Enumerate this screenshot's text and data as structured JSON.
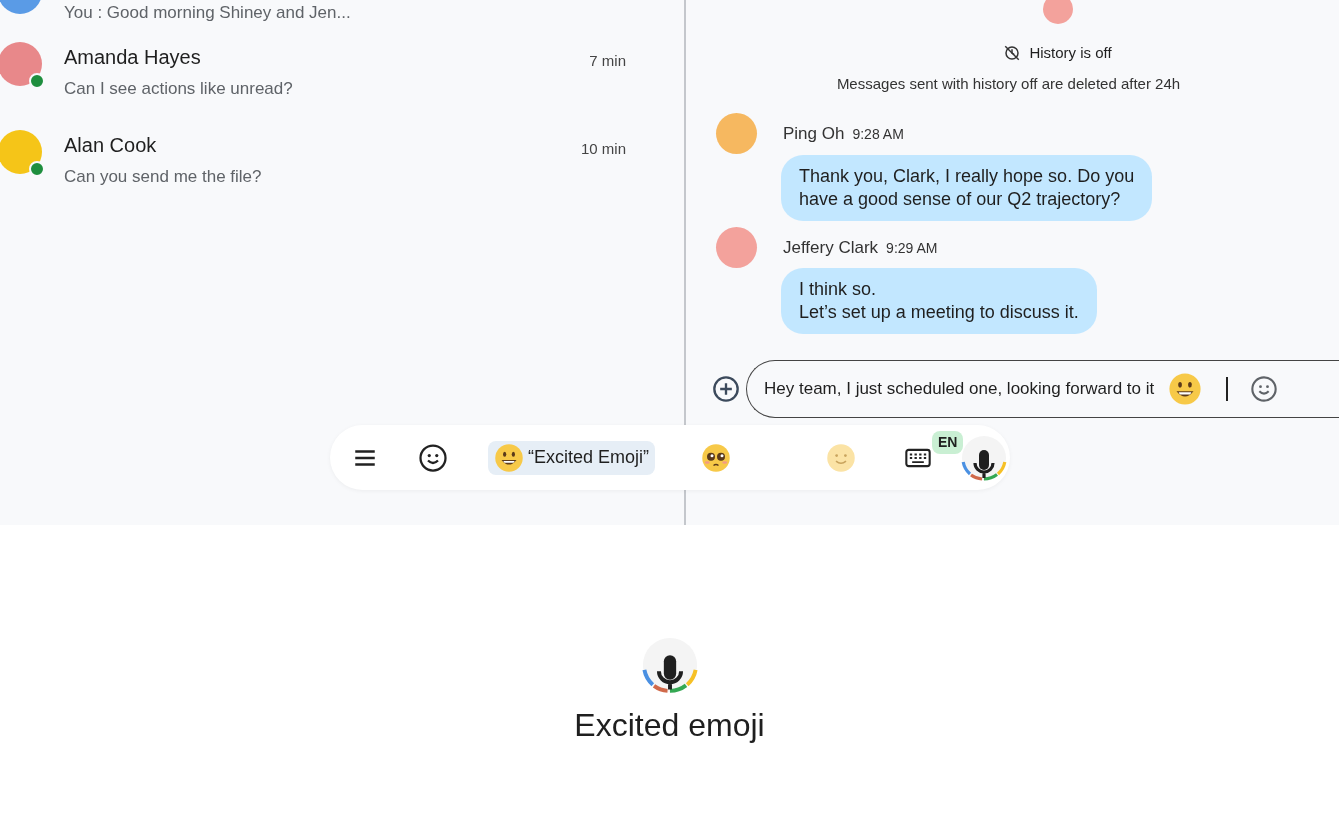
{
  "conversations": [
    {
      "preview": "You : Good morning Shiney and Jen...",
      "online": false,
      "color": "#5a9be6"
    },
    {
      "name": "Amanda Hayes",
      "preview": "Can I see actions like unread?",
      "time": "7 min",
      "online": true,
      "color": "#e8888a"
    },
    {
      "name": "Alan Cook",
      "preview": "Can you send me the file?",
      "time": "10 min",
      "online": true,
      "color": "#f5c518"
    }
  ],
  "chat": {
    "history_title": "History is off",
    "history_note": "Messages sent with history off are deleted after 24h",
    "messages": [
      {
        "sender": "Ping Oh",
        "time": "9:28 AM",
        "lines": [
          "Thank you, Clark, I really hope so. Do you",
          "have a good sense of our Q2 trajectory?"
        ],
        "color": "#f6b860"
      },
      {
        "sender": "Jeffery Clark",
        "time": "9:29 AM",
        "lines": [
          "I think so.",
          "Let’s set up a meeting to discuss it."
        ],
        "color": "#f3a29c"
      }
    ],
    "compose": {
      "value": "Hey team, I just scheduled one, looking forward to it"
    }
  },
  "keyboard": {
    "suggestions": [
      {
        "kind": "grin",
        "label": "“Excited Emoji”",
        "selected": true
      },
      {
        "kind": "pleading",
        "selected": false
      },
      {
        "kind": "smile",
        "selected": false
      }
    ],
    "language": "EN"
  },
  "voice": {
    "transcript": "Excited emoji"
  }
}
